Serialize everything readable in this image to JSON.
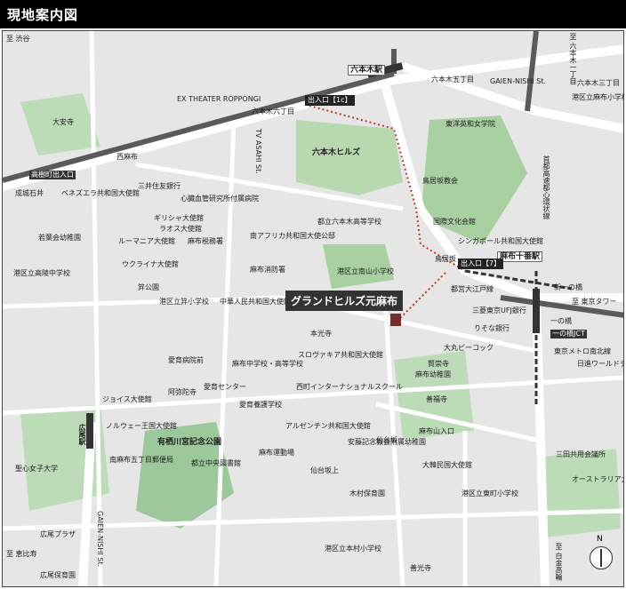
{
  "title": "現地案内図",
  "site_label": "グランドヒルズ元麻布",
  "stations": [
    "六本木駅",
    "麻布十番駅"
  ],
  "exits": [
    "出入口【1c】",
    "出入口【7】"
  ],
  "streets": [
    "高樹町出入口",
    "西麻布",
    "六本木六丁目",
    "TV ASAHI St.",
    "GAIEN-NISHI St.",
    "首都高速都心環状線",
    "鳥居坂",
    "都営大江戸線",
    "東京メトロ南北線",
    "麻布山入口",
    "仙台坂上",
    "仙台坂",
    "新一の橋",
    "一の橋",
    "一の橋JCT",
    "六本木五丁目",
    "六本木三丁目",
    "至 六本木一丁目",
    "至 東京タワー",
    "至 白金高輪",
    "至 恵比寿",
    "至 渋谷",
    "GAIEN-NISHI St."
  ],
  "landmarks": [
    "EX THEATER ROPPONGI",
    "六本木ヒルズ",
    "大安寺",
    "三井住友銀行",
    "成城石井",
    "ベネズエラ共和国大使館",
    "若葉会幼稚園",
    "港区立高陵中学校",
    "心臓血管研究所付属病院",
    "ギリシャ大使館",
    "ラオス大使館",
    "ルーマニア大使館",
    "ウクライナ大使館",
    "麻布税務署",
    "南アフリカ共和国大使公邸",
    "麻布消防署",
    "都立六本木高等学校",
    "港区立南山小学校",
    "笄公園",
    "港区立笄小学校",
    "中華人民共和国大使館",
    "本光寺",
    "愛育病院前",
    "麻布中学校・高等学校",
    "スロヴァキア共和国大使館",
    "大丸ピーコック",
    "賢崇寺",
    "麻布幼稚園",
    "善福寺",
    "有栖川宮記念公園",
    "都立中央図書館",
    "麻布運動場",
    "愛育養護学校",
    "西町インターナショナルスクール",
    "アルゼンチン共和国大使館",
    "安藤記念教会附属幼稚園",
    "大韓民国大使館",
    "木村保育園",
    "港区立東町小学校",
    "港区立本村小学校",
    "善光寺",
    "港区立東町小学校",
    "三田共用会議所",
    "オーストラリア大使館",
    "港区立麻布小学校",
    "東洋英和女学院",
    "鳥居坂教会",
    "国際文化会館",
    "シンガポール共和国大使館",
    "三菱東京UFJ銀行",
    "りそな銀行",
    "東京メトロ南北線",
    "日進ワールドデリカテッセン",
    "広尾駅",
    "聖心女子大学",
    "広尾プラザ",
    "広尾保育園",
    "愛育センター",
    "阿弥陀寺",
    "ノルウェー王国大使館",
    "ジョイス大使館",
    "南麻布五丁目郵便局"
  ],
  "colors": {
    "site": "#7a2b2b",
    "road_main": "#ffffff",
    "highway": "#5a5a5a",
    "green": "#9cc89c",
    "route": "#c0392b"
  }
}
